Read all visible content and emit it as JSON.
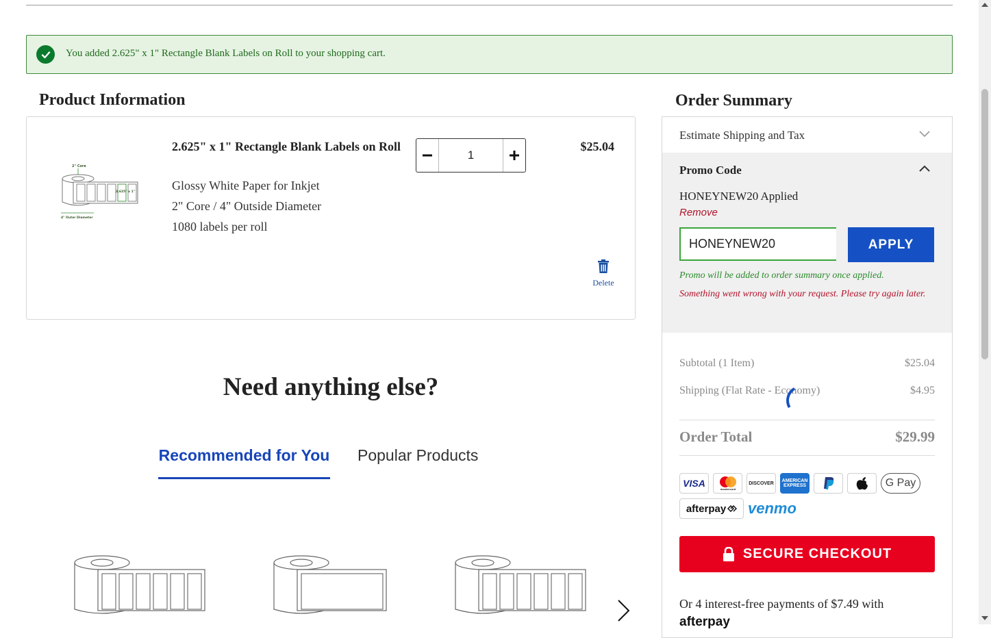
{
  "success": {
    "message": "You added 2.625\" x 1\" Rectangle Blank Labels on Roll to your shopping cart."
  },
  "product_section": {
    "heading": "Product Information",
    "item": {
      "title": "2.625\" x 1\" Rectangle Blank Labels on Roll",
      "specs": [
        "Glossy White Paper for Inkjet",
        "2\" Core / 4\" Outside Diameter",
        "1080 labels per roll"
      ],
      "quantity": "1",
      "price": "$25.04",
      "delete_label": "Delete",
      "image_labels": {
        "core": "2\" Core",
        "size": "2.625\" x 1\"",
        "outer": "4\" Outer Diameter"
      }
    }
  },
  "recommend": {
    "heading": "Need anything else?",
    "tabs": [
      {
        "label": "Recommended for You",
        "active": true
      },
      {
        "label": "Popular Products",
        "active": false
      }
    ]
  },
  "order_summary": {
    "heading": "Order Summary",
    "estimate_label": "Estimate Shipping and Tax",
    "promo": {
      "title": "Promo Code",
      "applied_text": "HONEYNEW20 Applied",
      "remove_label": "Remove",
      "input_value": "HONEYNEW20",
      "apply_label": "APPLY",
      "note_ok": "Promo will be added to order summary once applied.",
      "note_error": "Something went wrong with your request. Please try again later."
    },
    "subtotal_label": "Subtotal (1 Item)",
    "subtotal_value": "$25.04",
    "shipping_label": "Shipping (Flat Rate - Economy)",
    "shipping_value": "$4.95",
    "total_label": "Order Total",
    "total_value": "$29.99",
    "payment_methods": [
      "VISA",
      "mastercard",
      "DISCOVER",
      "AMERICAN EXPRESS",
      "PayPal",
      "Apple Pay",
      "G Pay",
      "afterpay",
      "venmo"
    ],
    "checkout_label": "SECURE CHECKOUT",
    "installments_text": "Or 4 interest-free payments of $7.49 with",
    "installments_brand": "afterpay"
  },
  "colors": {
    "accent_blue": "#1551c4",
    "checkout_red": "#e8001f",
    "success_green": "#0b7a2c",
    "error_red": "#b3122a"
  }
}
